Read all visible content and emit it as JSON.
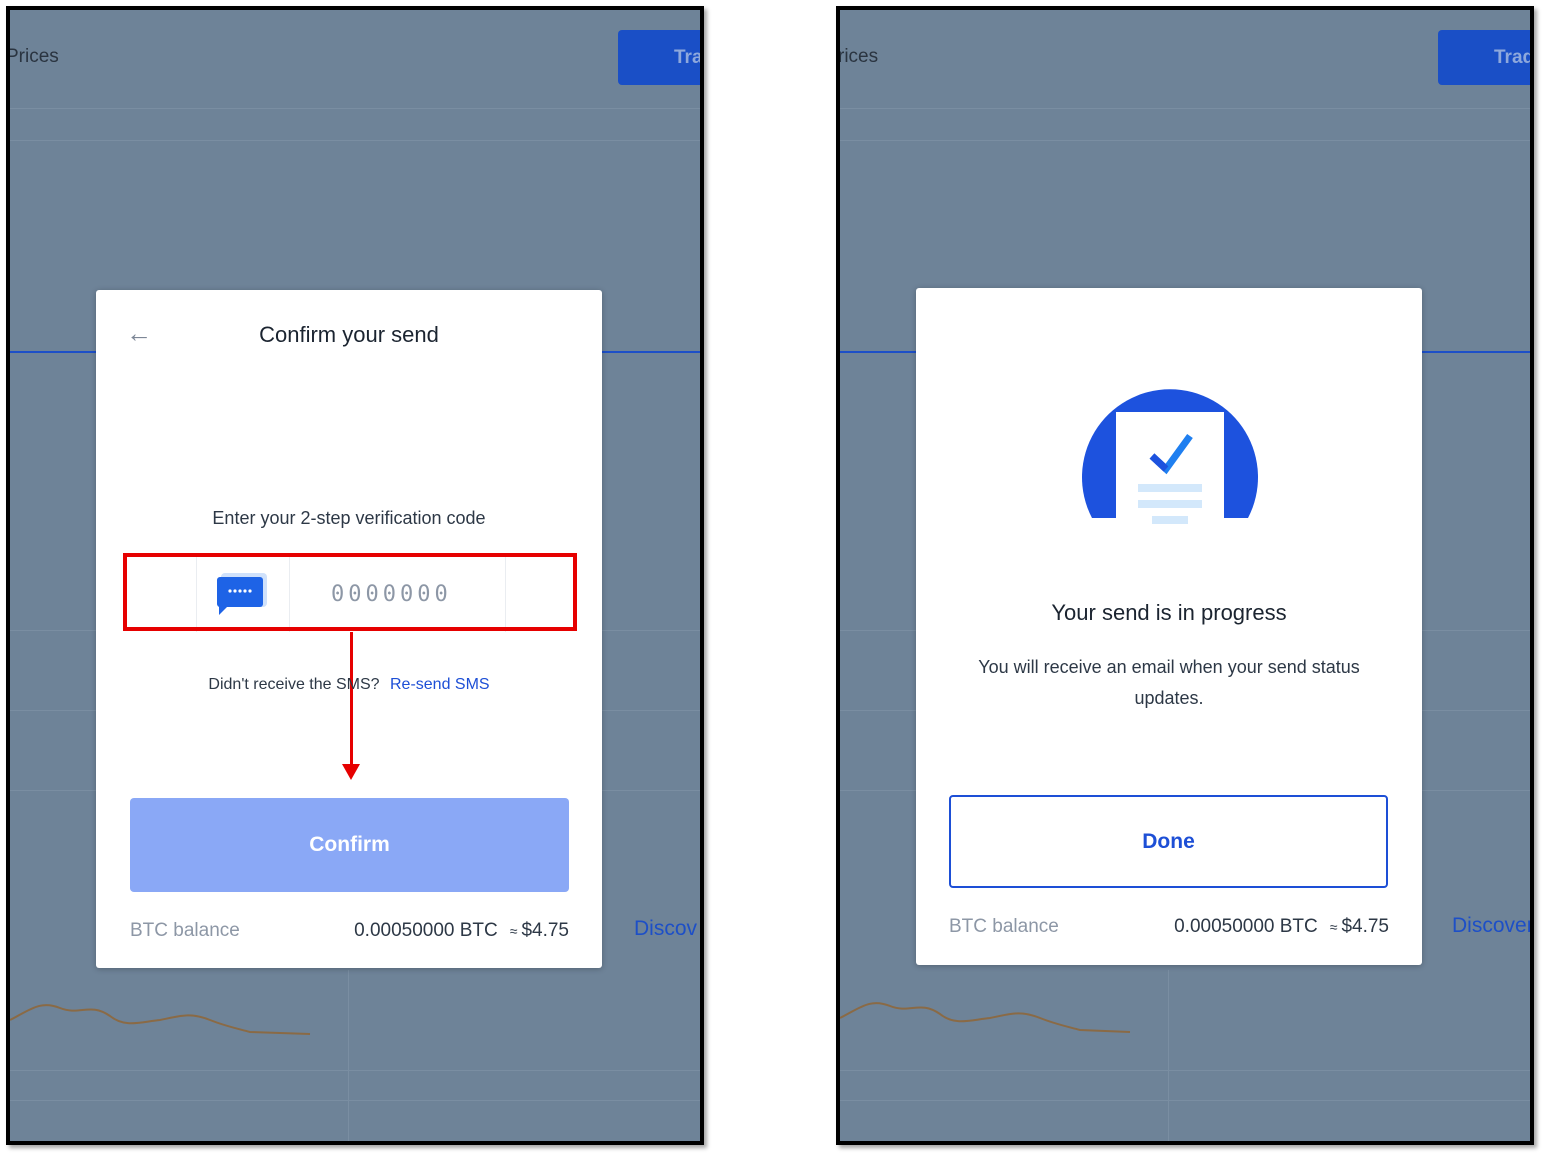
{
  "left": {
    "background": {
      "nav_prices": "Prices",
      "trade_button": "Tra",
      "discover_link": "Discov"
    },
    "modal": {
      "title": "Confirm your send",
      "prompt": "Enter your 2-step verification code",
      "code_placeholder": "0000000",
      "resend_question": "Didn't receive the SMS?",
      "resend_link": "Re-send SMS",
      "confirm_button": "Confirm",
      "balance_label": "BTC balance",
      "balance_btc": "0.00050000 BTC",
      "balance_approx": "≈",
      "balance_usd": "$4.75"
    }
  },
  "right": {
    "background": {
      "nav_prices": "rices",
      "trade_button": "Trade",
      "discover_link": "Discover"
    },
    "modal": {
      "title": "Your send is in progress",
      "body": "You will receive an email when your send status updates.",
      "done_button": "Done",
      "balance_label": "BTC balance",
      "balance_btc": "0.00050000 BTC",
      "balance_approx": "≈",
      "balance_usd": "$4.75"
    }
  },
  "colors": {
    "overlay": "#6e8398",
    "accent_blue": "#1d4fd6",
    "confirm_disabled": "#8aa8f6",
    "highlight_red": "#e60000"
  },
  "icons": [
    "back-arrow-icon",
    "sms-icon",
    "document-check-icon"
  ]
}
